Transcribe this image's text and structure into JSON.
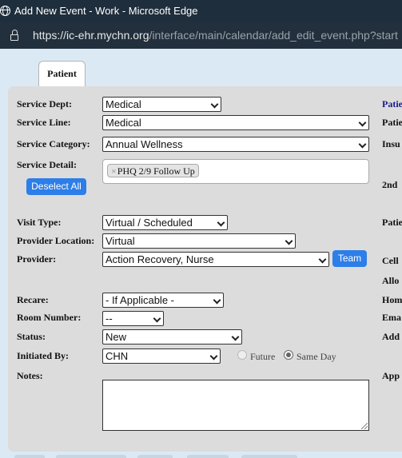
{
  "window": {
    "title": "Add New Event - Work - Microsoft Edge"
  },
  "address": {
    "host": "https://ic-ehr.mychn.org",
    "path": "/interface/main/calendar/add_edit_event.php?start"
  },
  "tab": {
    "label": "Patient"
  },
  "form": {
    "service_dept": {
      "label": "Service Dept:",
      "value": "Medical"
    },
    "service_line": {
      "label": "Service Line:",
      "value": "Medical"
    },
    "service_category": {
      "label": "Service Category:",
      "value": "Annual Wellness"
    },
    "service_detail": {
      "label": "Service Detail:",
      "chip": "PHQ 2/9 Follow Up",
      "chip_remove": "×"
    },
    "deselect_all": "Deselect All",
    "visit_type": {
      "label": "Visit Type:",
      "value": "Virtual / Scheduled"
    },
    "provider_location": {
      "label": "Provider Location:",
      "value": "Virtual"
    },
    "provider": {
      "label": "Provider:",
      "value": "Action Recovery, Nurse"
    },
    "team_button": "Team",
    "recare": {
      "label": "Recare:",
      "value": "- If Applicable -"
    },
    "room_number": {
      "label": "Room Number:",
      "value": "--"
    },
    "status": {
      "label": "Status:",
      "value": "New"
    },
    "initiated_by": {
      "label": "Initiated By:",
      "value": "CHN"
    },
    "timing": {
      "future": "Future",
      "same_day": "Same Day",
      "selected": "same_day"
    },
    "notes": {
      "label": "Notes:",
      "value": ""
    }
  },
  "right_column": {
    "labels": [
      "Patie",
      "Patie",
      "Insu",
      "2nd",
      "Patie",
      "Cell",
      "Allo",
      "Hom",
      "Ema",
      "Add",
      "App"
    ]
  }
}
